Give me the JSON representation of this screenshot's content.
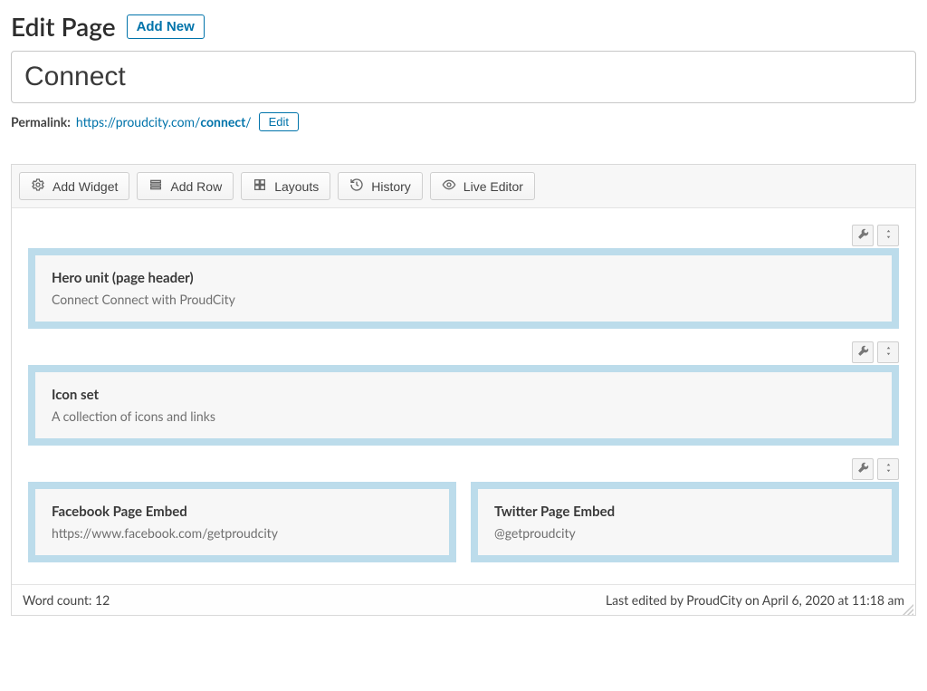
{
  "header": {
    "heading": "Edit Page",
    "add_new_label": "Add New"
  },
  "title_field": {
    "value": "Connect"
  },
  "permalink": {
    "label": "Permalink:",
    "base": "https://proudcity.com/",
    "slug": "connect",
    "trail": "/",
    "edit_label": "Edit"
  },
  "toolbar": {
    "add_widget": "Add Widget",
    "add_row": "Add Row",
    "layouts": "Layouts",
    "history": "History",
    "live_editor": "Live Editor"
  },
  "rows": [
    {
      "widgets": [
        {
          "title": "Hero unit (page header)",
          "sub": "Connect Connect with ProudCity"
        }
      ]
    },
    {
      "widgets": [
        {
          "title": "Icon set",
          "sub": "A collection of icons and links"
        }
      ]
    },
    {
      "widgets": [
        {
          "title": "Facebook Page Embed",
          "sub": "https://www.facebook.com/getproudcity"
        },
        {
          "title": "Twitter Page Embed",
          "sub": "@getproudcity"
        }
      ]
    }
  ],
  "footer": {
    "word_count_label": "Word count: ",
    "word_count": "12",
    "last_edited": "Last edited by ProudCity on April 6, 2020 at 11:18 am"
  }
}
